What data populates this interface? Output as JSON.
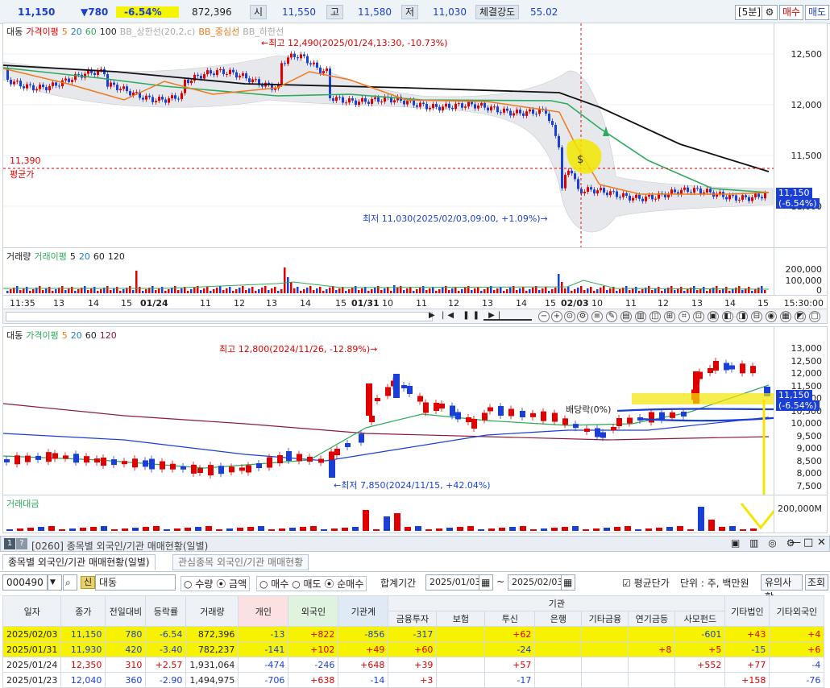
{
  "quote": {
    "price": "11,150",
    "change": "▼780",
    "change_pct": "-6.54%",
    "volume": "872,396",
    "open_label": "시",
    "open": "11,550",
    "high_label": "고",
    "high": "11,580",
    "low_label": "저",
    "low": "11,030",
    "strength_label": "체결강도",
    "strength": "55.02",
    "interval": "[5분]",
    "buy": "매수",
    "sell": "매도"
  },
  "chart1": {
    "legend": [
      "대동",
      "가격이평",
      "5",
      "20",
      "60",
      "100",
      "BB_상한선(20,2,c)",
      "BB_중심선",
      "BB_하한선"
    ],
    "y_ticks": [
      "12,500",
      "12,000",
      "11,500",
      "11,000"
    ],
    "avg_value": "11,390",
    "avg_label": "평균가",
    "high_ann": "←최고 12,490(2025/01/24,13:30, -10.73%)",
    "low_ann": "최저 11,030(2025/02/03,09:00, +1.09%)→",
    "price_tag": "11,150",
    "price_tag_pct": "(-6.54%)",
    "vol_legend": [
      "거래량",
      "거래이평",
      "5",
      "20",
      "60",
      "120"
    ],
    "vol_ticks": [
      "200,000",
      "100,000",
      "0"
    ],
    "x_ticks": [
      "11:35",
      "13",
      "14",
      "15",
      "01/24",
      "11",
      "12",
      "13",
      "14",
      "15",
      "01/31",
      "10",
      "11",
      "12",
      "13",
      "14",
      "15",
      "02/03",
      "10",
      "11",
      "12",
      "13",
      "14",
      "15"
    ],
    "x_end": "15:30:00",
    "colors": {
      "ma5": "#f07a1a",
      "ma20": "#1a7fd0",
      "ma60": "#2eaa5c",
      "ma100": "#111111"
    }
  },
  "chart2": {
    "legend": [
      "대동",
      "가격이평",
      "5",
      "20",
      "60",
      "120"
    ],
    "y_ticks": [
      "13,000",
      "12,500",
      "12,000",
      "11,500",
      "11,000",
      "10,500",
      "10,000",
      "9,500",
      "9,000",
      "8,500",
      "8,000",
      "7,500"
    ],
    "high_ann": "최고 12,800(2024/11/26, -12.89%)→",
    "low_ann": "←최저 7,850(2024/11/15, +42.04%)",
    "div_ann": "배당락(0%)",
    "price_tag": "11,150",
    "price_tag_pct": "(-6.54%)",
    "amt_label": "거래대금",
    "amt_tick": "200,000M"
  },
  "window": {
    "num": "1",
    "help": "?",
    "title": "[0260] 종목별 외국인/기관 매매현황(일별)",
    "tab1": "종목별 외국인/기관 매매현황(일별)",
    "tab2": "관심종목 외국인/기관 매매현황"
  },
  "controls": {
    "code": "000490",
    "badge": "신",
    "name": "대동",
    "r_qty": "수량",
    "r_amt": "금액",
    "r_buy": "매수",
    "r_sell": "매도",
    "r_net": "순매수",
    "period_label": "합계기간",
    "date_from": "2025/01/03",
    "date_to": "2025/02/03",
    "avg_chk": "평균단가",
    "unit": "단위 : 주, 백만원",
    "notice": "유의사항",
    "query": "조회"
  },
  "table": {
    "headers": [
      "일자",
      "종가",
      "전일대비",
      "등락률",
      "거래량",
      "개인",
      "외국인",
      "기관계",
      "금융투자",
      "보험",
      "투신",
      "은행",
      "기타금융",
      "연기금등",
      "사모펀드",
      "기타법인",
      "기타외국인"
    ],
    "inst_group": "기관",
    "rows": [
      [
        "2025/02/03",
        "11,150",
        "780",
        "-6.54",
        "872,396",
        "-13",
        "+822",
        "-856",
        "-317",
        "",
        "+62",
        "",
        "",
        "",
        "-601",
        "+43",
        "+4"
      ],
      [
        "2025/01/31",
        "11,930",
        "420",
        "-3.40",
        "782,237",
        "-141",
        "+102",
        "+49",
        "+60",
        "",
        "-24",
        "",
        "",
        "+8",
        "+5",
        "-15",
        "+6"
      ],
      [
        "2025/01/24",
        "12,350",
        "310",
        "+2.57",
        "1,931,064",
        "-474",
        "-246",
        "+648",
        "+39",
        "",
        "+57",
        "",
        "",
        "",
        "+552",
        "+77",
        "-4"
      ],
      [
        "2025/01/23",
        "12,040",
        "360",
        "-2.90",
        "1,494,975",
        "-706",
        "+638",
        "-14",
        "+3",
        "",
        "-17",
        "",
        "",
        "",
        "",
        "+158",
        "-76"
      ]
    ]
  }
}
